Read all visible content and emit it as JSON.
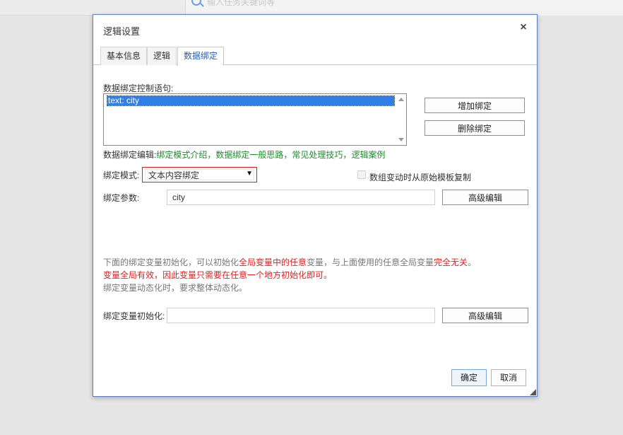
{
  "background": {
    "search_placeholder": "输入任务关键词等"
  },
  "dialog": {
    "title": "逻辑设置",
    "close_glyph": "×",
    "tabs": [
      {
        "label": "基本信息"
      },
      {
        "label": "逻辑"
      },
      {
        "label": "数据绑定",
        "active": true
      }
    ],
    "binding_statement_label": "数据绑定控制语句:",
    "binding_list": [
      "text: city"
    ],
    "add_binding_button": "增加绑定",
    "remove_binding_button": "删除绑定",
    "edit_label": "数据绑定编辑:",
    "help_links": [
      "绑定模式介绍",
      "数据绑定一般思路",
      "常见处理技巧",
      "逻辑案例"
    ],
    "link_separator": "，",
    "mode_label": "绑定模式:",
    "mode_value": "文本内容绑定",
    "copy_template_checkbox_label": "数组变动时从原始模板复制",
    "copy_template_checked": false,
    "param_label": "绑定参数:",
    "param_value": "city",
    "advanced_edit_button": "高级编辑",
    "notes": {
      "line1_a": "下面的绑定变量初始化，可以初始化",
      "line1_b": "全局变量中的任意",
      "line1_c": "变量，与上面使用的任意全局变量",
      "line1_d": "完全无关",
      "line1_e": "。",
      "line2": "变量全局有效，因此变量只需要在任意一个地方初始化即可。",
      "line3": "绑定变量动态化时，要求整体动态化。"
    },
    "init_label": "绑定变量初始化:",
    "init_value": "",
    "ok_button": "确定",
    "cancel_button": "取消"
  },
  "colors": {
    "accent": "#2a5db0",
    "link_green": "#1f8b2c",
    "warning_red": "#e02020",
    "selection_blue": "#2f7fe6"
  }
}
